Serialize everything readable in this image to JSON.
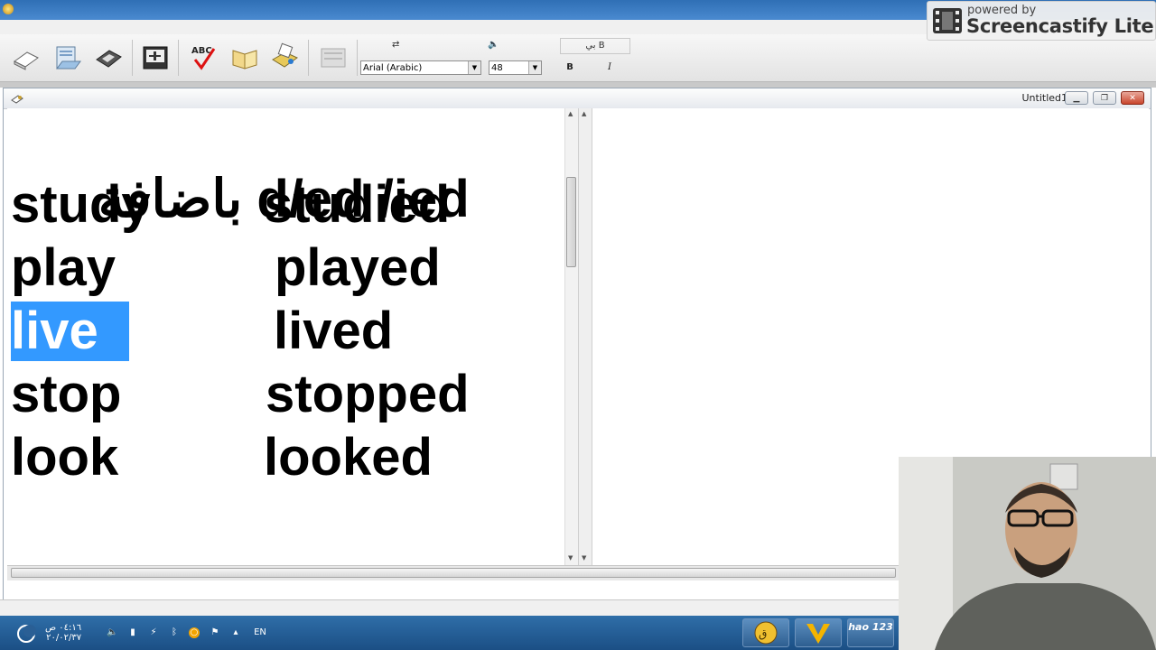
{
  "toolbar": {
    "font_name": "Arial (Arabic)",
    "font_size": "48",
    "bold_label": "B",
    "italic_label": "I",
    "top_label_1": "بي B",
    "buttons": [
      "new-document-icon",
      "open-folder-icon",
      "save-disk-icon",
      "template-icon",
      "spellcheck-icon",
      "dictionary-book-icon",
      "print-icon",
      "disabled-tool-icon"
    ]
  },
  "document": {
    "window_title": "Untitled1",
    "lines": [
      {
        "left": "باضافة d/ed /ied",
        "right": ""
      },
      {
        "left": "study",
        "right": "studied"
      },
      {
        "left": "play",
        "right": "played"
      },
      {
        "left": "live",
        "right": "lived"
      },
      {
        "left": "stop",
        "right": "stopped"
      },
      {
        "left": "look",
        "right": "looked"
      }
    ],
    "selected_word": "live"
  },
  "screencastify": {
    "powered_by": "powered by",
    "brand": "Screencastify Lite"
  },
  "taskbar": {
    "time": "٠٤:١٦ ص",
    "date": "٢٠/٠٢/٣٧",
    "language": "EN",
    "apps": [
      "quran-app-icon",
      "vectorize-app-icon",
      "hao123-app-icon"
    ],
    "hao_label": "hao 123"
  },
  "colors": {
    "selection": "#3399ff",
    "taskbar": "#1b4f85"
  }
}
